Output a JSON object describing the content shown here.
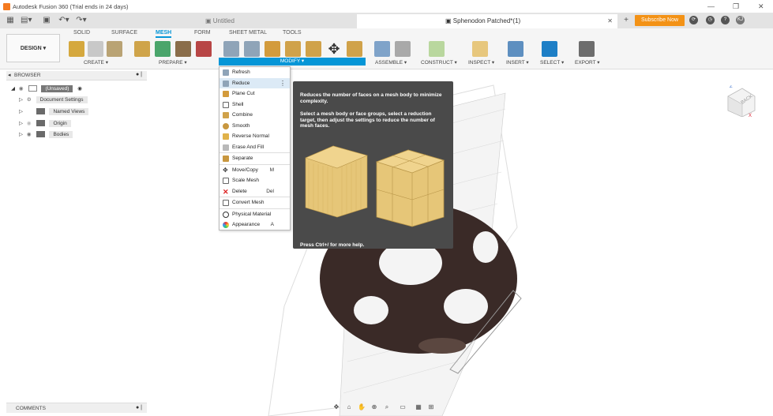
{
  "titlebar": {
    "title": "Autodesk Fusion 360 (Trial ends in 24 days)"
  },
  "tabs": {
    "untitled": "Untitled",
    "active_doc": "Sphenodon Patched*(1)"
  },
  "subscribe": "Subscribe Now",
  "user_initials": "KJ",
  "workspace": "DESIGN ▾",
  "ribbon_tabs": [
    "SOLID",
    "SURFACE",
    "MESH",
    "FORM",
    "SHEET METAL",
    "TOOLS"
  ],
  "groups": {
    "create": "CREATE ▾",
    "prepare": "PREPARE ▾",
    "modify": "MODIFY ▾",
    "assemble": "ASSEMBLE ▾",
    "construct": "CONSTRUCT ▾",
    "inspect": "INSPECT ▾",
    "insert": "INSERT ▾",
    "select": "SELECT ▾",
    "export": "EXPORT ▾"
  },
  "browser": {
    "title": "BROWSER",
    "root": "(Unsaved)",
    "items": [
      "Document Settings",
      "Named Views",
      "Origin",
      "Bodies"
    ]
  },
  "comments": "COMMENTS",
  "modify_menu": {
    "items": [
      {
        "label": "Refresh",
        "shortcut": ""
      },
      {
        "label": "Reduce",
        "shortcut": ""
      },
      {
        "label": "Plane Cut",
        "shortcut": ""
      },
      {
        "label": "Shell",
        "shortcut": ""
      },
      {
        "label": "Combine",
        "shortcut": ""
      },
      {
        "label": "Smooth",
        "shortcut": ""
      },
      {
        "label": "Reverse Normal",
        "shortcut": ""
      },
      {
        "label": "Erase And Fill",
        "shortcut": ""
      },
      {
        "label": "Separate",
        "shortcut": ""
      },
      {
        "label": "Move/Copy",
        "shortcut": "M"
      },
      {
        "label": "Scale Mesh",
        "shortcut": ""
      },
      {
        "label": "Delete",
        "shortcut": "Del"
      },
      {
        "label": "Convert Mesh",
        "shortcut": ""
      },
      {
        "label": "Physical Material",
        "shortcut": ""
      },
      {
        "label": "Appearance",
        "shortcut": "A"
      }
    ]
  },
  "tooltip": {
    "heading": "Reduces the number of faces on a mesh body to minimize complexity.",
    "body": "Select a mesh body or face groups, select a reduction target, then adjust the settings to reduce the number of mesh faces.",
    "footer": "Press Ctrl+/ for more help."
  },
  "viewcube_label": "BACK",
  "colors": {
    "accent": "#0696d7",
    "subscribe": "#f39216",
    "tooltip_bg": "#4a4a4a",
    "model": "#3a2a27"
  }
}
